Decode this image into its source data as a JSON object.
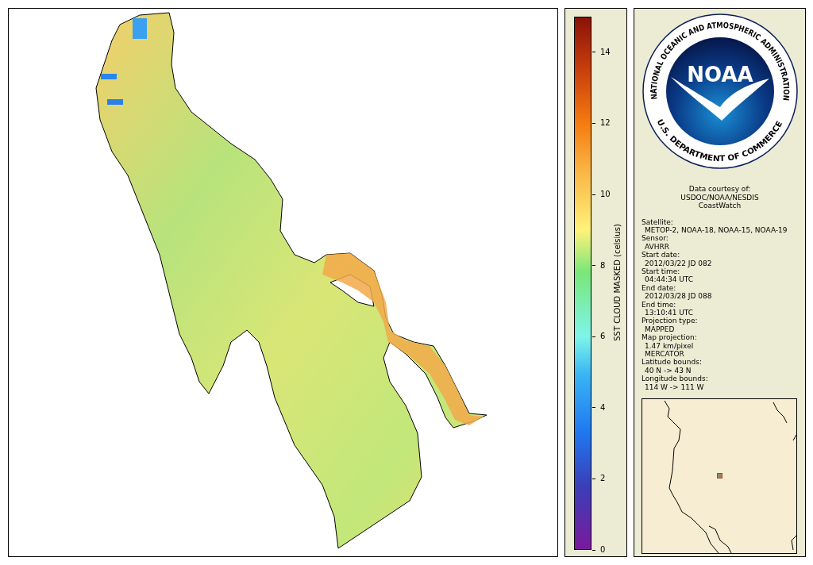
{
  "colorbar": {
    "title": "SST CLOUD MASKED (celsius)",
    "ticks": [
      "14",
      "12",
      "10",
      "8",
      "6",
      "4",
      "2",
      "0"
    ]
  },
  "logo": {
    "ring_top": "NATIONAL OCEANIC AND ATMOSPHERIC ADMINISTRATION",
    "ring_bottom": "U.S. DEPARTMENT OF COMMERCE",
    "center": "NOAA"
  },
  "credit": [
    "Data courtesy of:",
    "USDOC/NOAA/NESDIS",
    "CoastWatch"
  ],
  "metadata": [
    {
      "label": "Satellite:",
      "values": [
        "METOP-2, NOAA-18, NOAA-15, NOAA-19"
      ]
    },
    {
      "label": "Sensor:",
      "values": [
        "AVHRR"
      ]
    },
    {
      "label": "Start date:",
      "values": [
        "2012/03/22 JD 082"
      ]
    },
    {
      "label": "Start time:",
      "values": [
        "04:44:34 UTC"
      ]
    },
    {
      "label": "End date:",
      "values": [
        "2012/03/28 JD 088"
      ]
    },
    {
      "label": "End time:",
      "values": [
        "13:10:41 UTC"
      ]
    },
    {
      "label": "Projection type:",
      "values": [
        "MAPPED"
      ]
    },
    {
      "label": "Map projection:",
      "values": [
        "1.47 km/pixel",
        "MERCATOR"
      ]
    },
    {
      "label": "Latitude bounds:",
      "values": [
        "40 N -> 43 N"
      ]
    },
    {
      "label": "Longitude bounds:",
      "values": [
        "114 W -> 111 W"
      ]
    }
  ]
}
